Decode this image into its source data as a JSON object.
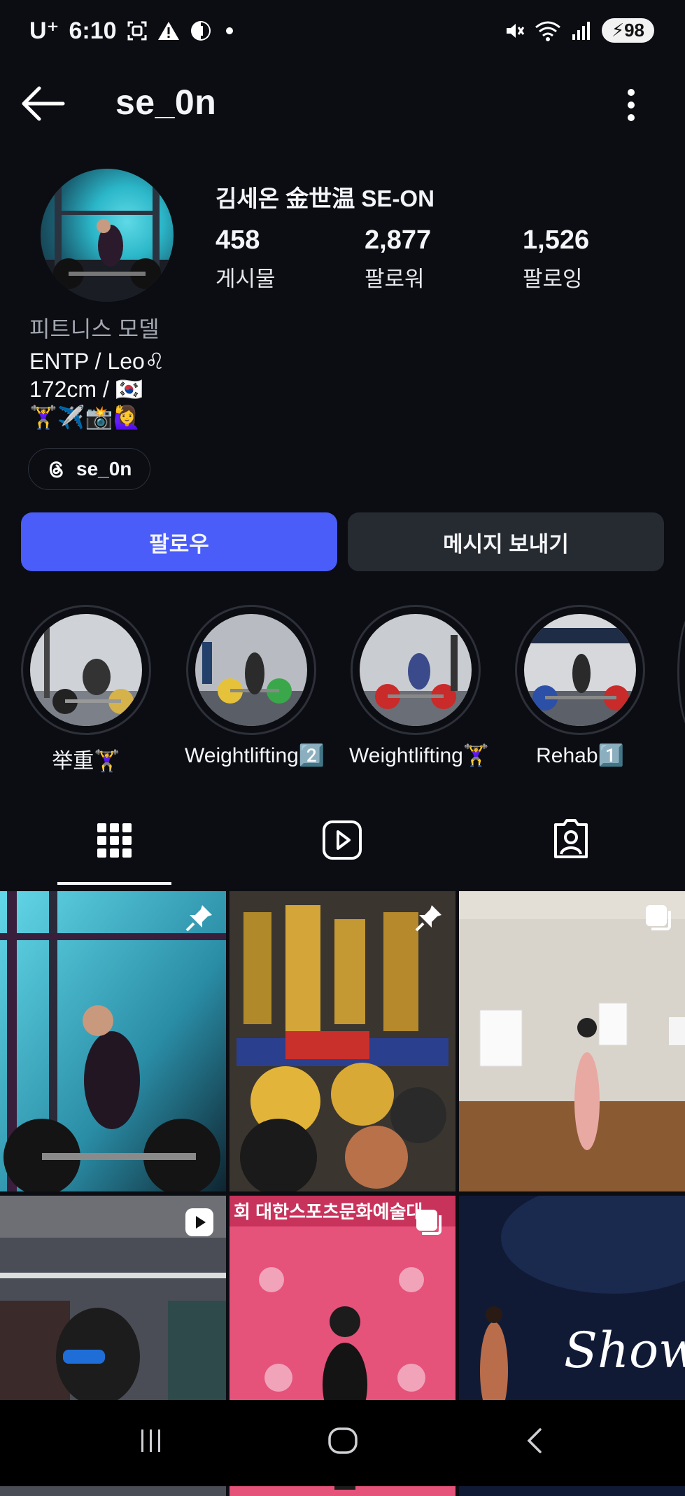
{
  "status_bar": {
    "carrier": "U⁺",
    "time": "6:10",
    "battery": "98"
  },
  "header": {
    "username": "se_0n"
  },
  "profile": {
    "full_name": "김세온 金世温 SE-ON",
    "stats": [
      {
        "value": "458",
        "label": "게시물"
      },
      {
        "value": "2,877",
        "label": "팔로워"
      },
      {
        "value": "1,526",
        "label": "팔로잉"
      }
    ],
    "category": "피트니스 모델",
    "bio_lines": [
      "ENTP / Leo♌",
      "172cm / 🇰🇷",
      "🏋️‍♀️✈️📸🙋‍♀️"
    ],
    "threads_handle": "se_0n"
  },
  "actions": {
    "follow_label": "팔로우",
    "message_label": "메시지 보내기"
  },
  "highlights": [
    {
      "label": "举重🏋️‍♀️"
    },
    {
      "label": "Weightlifting2️⃣"
    },
    {
      "label": "Weightlifting🏋️‍♀️"
    },
    {
      "label": "Rehab1️⃣"
    }
  ],
  "tabs": [
    {
      "name": "posts-grid"
    },
    {
      "name": "reels"
    },
    {
      "name": "tagged"
    }
  ],
  "grid_posts": [
    {
      "badge": "pin-icon",
      "photo_text": ""
    },
    {
      "badge": "pin-icon",
      "photo_text": ""
    },
    {
      "badge": "carousel-icon",
      "photo_text": ""
    },
    {
      "badge": "reel-icon",
      "photo_text": ""
    },
    {
      "badge": "carousel-icon",
      "photo_text": "회 대한스포츠문화예술대"
    },
    {
      "badge": "",
      "photo_text": "Show"
    }
  ],
  "colors": {
    "background": "#0b0d13",
    "follow_button": "#4a5df9",
    "message_button": "#262a31"
  }
}
